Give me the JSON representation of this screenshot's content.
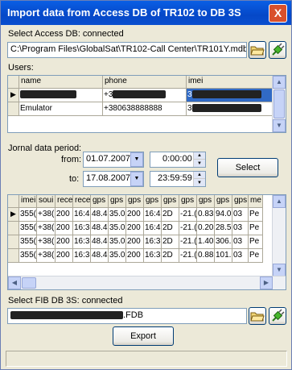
{
  "window": {
    "title": "Import data from Access DB of TR102 to DB 3S",
    "close": "X"
  },
  "access": {
    "label": "Select Access DB: connected",
    "path": "C:\\Program Files\\GlobalSat\\TR102-Call Center\\TR101Y.mdb"
  },
  "users": {
    "label": "Users:",
    "columns": [
      "name",
      "phone",
      "imei"
    ],
    "rows": [
      {
        "marker": "▶",
        "name": "",
        "phone": "+3",
        "imei": "3"
      },
      {
        "marker": "",
        "name": "Emulator",
        "phone": "+380638888888",
        "imei": "3"
      }
    ]
  },
  "period": {
    "label": "Jornal data period:",
    "from_label": "from:",
    "to_label": "to:",
    "from_date": "01.07.2007",
    "from_time": "0:00:00",
    "to_date": "17.08.2007",
    "to_time": "23:59:59",
    "select_button": "Select"
  },
  "journal": {
    "columns": [
      "imei",
      "soui",
      "rece",
      "rece",
      "gps",
      "gps",
      "gps",
      "gps",
      "gps",
      "gps",
      "gps",
      "gps",
      "gps",
      "me"
    ],
    "rows": [
      {
        "marker": "▶",
        "cells": [
          "355(",
          "+38(",
          "200",
          "16:4",
          "48.4",
          "35.0",
          "200",
          "16:4",
          "2D",
          "-21.(",
          "0.83",
          "94.0",
          "03",
          "Pe"
        ]
      },
      {
        "marker": "",
        "cells": [
          "355(",
          "+38(",
          "200",
          "16:3",
          "48.4",
          "35.0",
          "200",
          "16:4",
          "2D",
          "-21.(",
          "0.20",
          "28.5",
          "03",
          "Pe"
        ]
      },
      {
        "marker": "",
        "cells": [
          "355(",
          "+38(",
          "200",
          "16:3",
          "48.4",
          "35.0",
          "200",
          "16:3",
          "2D",
          "-21.(",
          "1.40",
          "306.",
          "03",
          "Pe"
        ]
      },
      {
        "marker": "",
        "cells": [
          "355(",
          "+38(",
          "200",
          "16:3",
          "48.4",
          "35.0",
          "200",
          "16:3",
          "2D",
          "-21.(",
          "0.88",
          "101.",
          "03",
          "Pe"
        ]
      }
    ]
  },
  "fib": {
    "label": "Select FIB DB 3S: connected",
    "path_suffix": ".FDB",
    "export_button": "Export"
  },
  "icons": {
    "open": "folder-open-icon",
    "connect": "plug-icon"
  }
}
